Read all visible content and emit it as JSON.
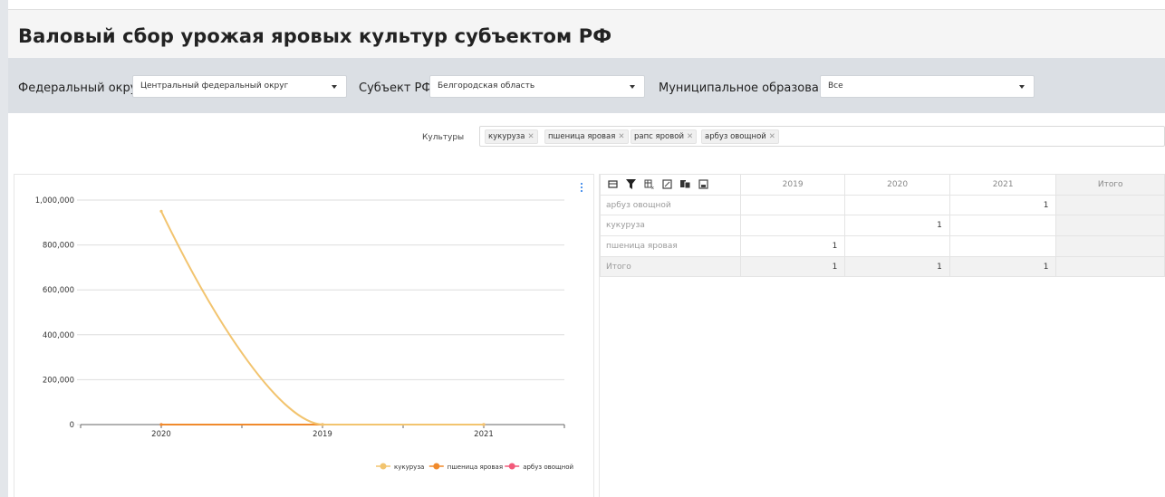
{
  "page": {
    "title": "Валовый сбор урожая яровых культур субъектом РФ"
  },
  "filters": {
    "federal_district": {
      "label": "Федеральный округ",
      "value": "Центральный федеральный округ"
    },
    "subject": {
      "label": "Субъект РФ",
      "value": "Белгородская область"
    },
    "municipality": {
      "label": "Муниципальное образование",
      "value": "Все"
    }
  },
  "cultures": {
    "label": "Культуры",
    "tags": [
      "кукуруза",
      "пшеница яровая",
      "рапс яровой",
      "арбуз овощной"
    ]
  },
  "chart_data": {
    "type": "line",
    "categories": [
      "2020",
      "2019",
      "2021"
    ],
    "y_ticks": [
      "1,000,000",
      "800,000",
      "600,000",
      "400,000",
      "200,000",
      "0"
    ],
    "ylim": [
      0,
      1000000
    ],
    "grid": true,
    "legend_position": "bottom-right",
    "series": [
      {
        "name": "кукуруза",
        "values": [
          950000,
          0,
          0
        ],
        "color": "#f2c46f"
      },
      {
        "name": "пшеница яровая",
        "values": [
          0,
          0,
          0
        ],
        "color": "#f08a2c"
      },
      {
        "name": "арбуз овощной",
        "values": [
          0,
          0,
          0
        ],
        "color": "#f25a7a"
      }
    ]
  },
  "pivot": {
    "toolbar_icons": [
      "fields-icon",
      "filter-icon",
      "format-icon",
      "export-icon",
      "copy-icon",
      "save-icon"
    ],
    "columns": [
      "2019",
      "2020",
      "2021",
      "Итого"
    ],
    "rows": [
      {
        "label": "арбуз овощной",
        "values": [
          "",
          "",
          "1",
          ""
        ]
      },
      {
        "label": "кукуруза",
        "values": [
          "",
          "1",
          "",
          ""
        ]
      },
      {
        "label": "пшеница яровая",
        "values": [
          "1",
          "",
          "",
          ""
        ]
      },
      {
        "label": "Итого",
        "values": [
          "1",
          "1",
          "1",
          ""
        ]
      }
    ]
  }
}
